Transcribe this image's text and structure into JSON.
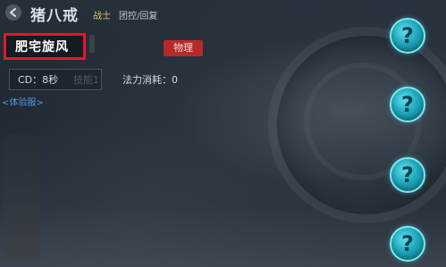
{
  "hero": {
    "name": "猪八戒",
    "role": "战士",
    "tags": "团控/回复"
  },
  "skill": {
    "name": "肥宅旋风",
    "type_badge": "物理",
    "cooldown": "CD：8秒",
    "mana_cost": "法力消耗：0",
    "ghost_text": "技能1"
  },
  "trial_link": "<体验服>",
  "help_buttons": [
    {
      "glyph": "?"
    },
    {
      "glyph": "?"
    },
    {
      "glyph": "?"
    },
    {
      "glyph": "?"
    }
  ],
  "colors": {
    "highlight_border": "#e0192d",
    "type_badge_bg": "#b82a2a",
    "role_text": "#e1c25a",
    "link_text": "#4f97e3",
    "help_button": "#1fa9bf"
  },
  "icons": {
    "back": "back-arrow-icon",
    "help": "question-mark-icon"
  }
}
